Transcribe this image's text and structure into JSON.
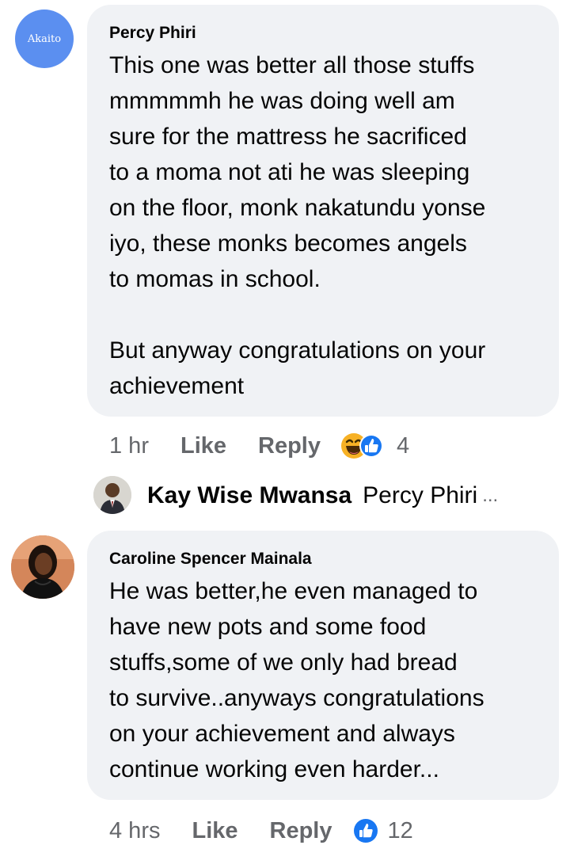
{
  "comments": [
    {
      "avatar_text": "Akaito",
      "author": "Percy Phiri",
      "text": "This one was better all those stuffs\nmmmmmh he was doing well am\nsure for the mattress he sacrificed\nto a moma not ati he was sleeping\non the floor, monk nakatundu yonse\niyo, these monks becomes angels\nto momas in school.\n\nBut anyway congratulations on your\nachievement",
      "time": "1 hr",
      "like_label": "Like",
      "reply_label": "Reply",
      "reaction_icons": [
        "haha-icon",
        "like-icon"
      ],
      "reaction_count": "4"
    },
    {
      "author": "Caroline Spencer Mainala",
      "text": "He was better,he even managed to\nhave new pots and some food\nstuffs,some of we only had bread\nto survive..anyways congratulations\non your achievement and always\ncontinue working even harder...",
      "time": "4 hrs",
      "like_label": "Like",
      "reply_label": "Reply",
      "reaction_icons": [
        "like-icon"
      ],
      "reaction_count": "12"
    }
  ],
  "reply_preview": {
    "author": "Kay Wise Mwansa",
    "snippet": "Percy Phiri",
    "ellipsis": "..."
  },
  "colors": {
    "bubble": "#f0f2f5",
    "meta_text": "#65676b",
    "like_blue": "#1877f2",
    "haha_yellow": "#f7b125"
  }
}
